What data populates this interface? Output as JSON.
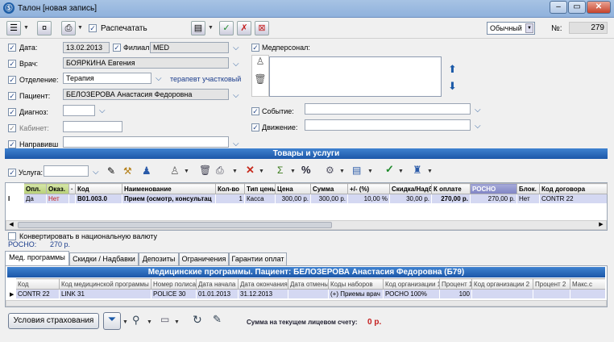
{
  "window": {
    "title": "Талон [новая запись]",
    "icon_glyph": "Ⓢ",
    "min": "‒",
    "max": "▭",
    "close": "✕"
  },
  "toolbar": {
    "print_label": "Распечатать",
    "mode_value": "Обычный",
    "num_label": "№:",
    "num_value": "279"
  },
  "form": {
    "date_label": "Дата:",
    "date_value": "13.02.2013",
    "branch_label": "Филиал:",
    "branch_value": "MED",
    "doctor_label": "Врач:",
    "doctor_value": "БОЯРКИНА Евгения",
    "dept_label": "Отделение:",
    "dept_value": "Терапия",
    "dept_extra": "терапевт участковый",
    "patient_label": "Пациент:",
    "patient_value": "БЕЛОЗЕРОВА Анастасия Федоровна",
    "diag_label": "Диагноз:",
    "cabinet_label": "Кабинет:",
    "referral_label": "Направивш",
    "staff_label": "Медперсонал:",
    "event_label": "Событие:",
    "movement_label": "Движение:"
  },
  "services": {
    "bar_title": "Товары и услуги",
    "service_label": "Услуга:",
    "columns": [
      "Опл.",
      "Оказ.",
      "·",
      "Код",
      "Наименование",
      "Кол-во",
      "Тип цены",
      "Цена",
      "Сумма",
      "+/- (%)",
      "Скидка/Надбавка",
      "К оплате",
      "РОСНО",
      "Блок.",
      "Код договора"
    ],
    "rows": [
      {
        "marker": "I",
        "paid": "Да",
        "done": "Нет",
        "code": "В01.003.0",
        "name": "Прием (осмотр, консультац",
        "qty": "1",
        "price_type": "Касса",
        "price": "300,00 р.",
        "sum": "300,00 р.",
        "pct": "10,00 %",
        "discount": "30,00 р.",
        "topay": "270,00 р.",
        "rosno": "270,00 р.",
        "block": "Нет",
        "contract": "CONTR 22"
      }
    ],
    "convert_label": "Конвертировать в национальную валюту",
    "rosno_label": "РОСНО:",
    "rosno_value": "270 р."
  },
  "tabs": [
    "Мед. программы",
    "Скидки / Надбавки",
    "Депозиты",
    "Ограничения",
    "Гарантии оплат"
  ],
  "programs": {
    "bar_title": "Медицинские программы. Пациент: БЕЛОЗЕРОВА Анастасия Федоровна (Б79)",
    "columns": [
      "Код",
      "Код медицинской программы",
      "Номер полиса",
      "Дата начала",
      "Дата окончания",
      "Дата отмены",
      "Коды наборов",
      "Код организации 1",
      "Процент 1",
      "Код организации 2",
      "Процент 2",
      "Макс.с"
    ],
    "rows": [
      {
        "code": "CONTR 22",
        "program": "LINK 31",
        "policy": "POLICE 30",
        "start": "01.01.2013",
        "end": "31.12.2013",
        "cancel": "",
        "sets": "(+) Приемы врач",
        "org1": "РОСНО 100%",
        "pct1": "100",
        "org2": "",
        "pct2": "",
        "max": ""
      }
    ]
  },
  "footer": {
    "insurance_button": "Условия страхования",
    "balance_label": "Сумма на текущем лицевом счету:",
    "balance_value": "0 р."
  }
}
